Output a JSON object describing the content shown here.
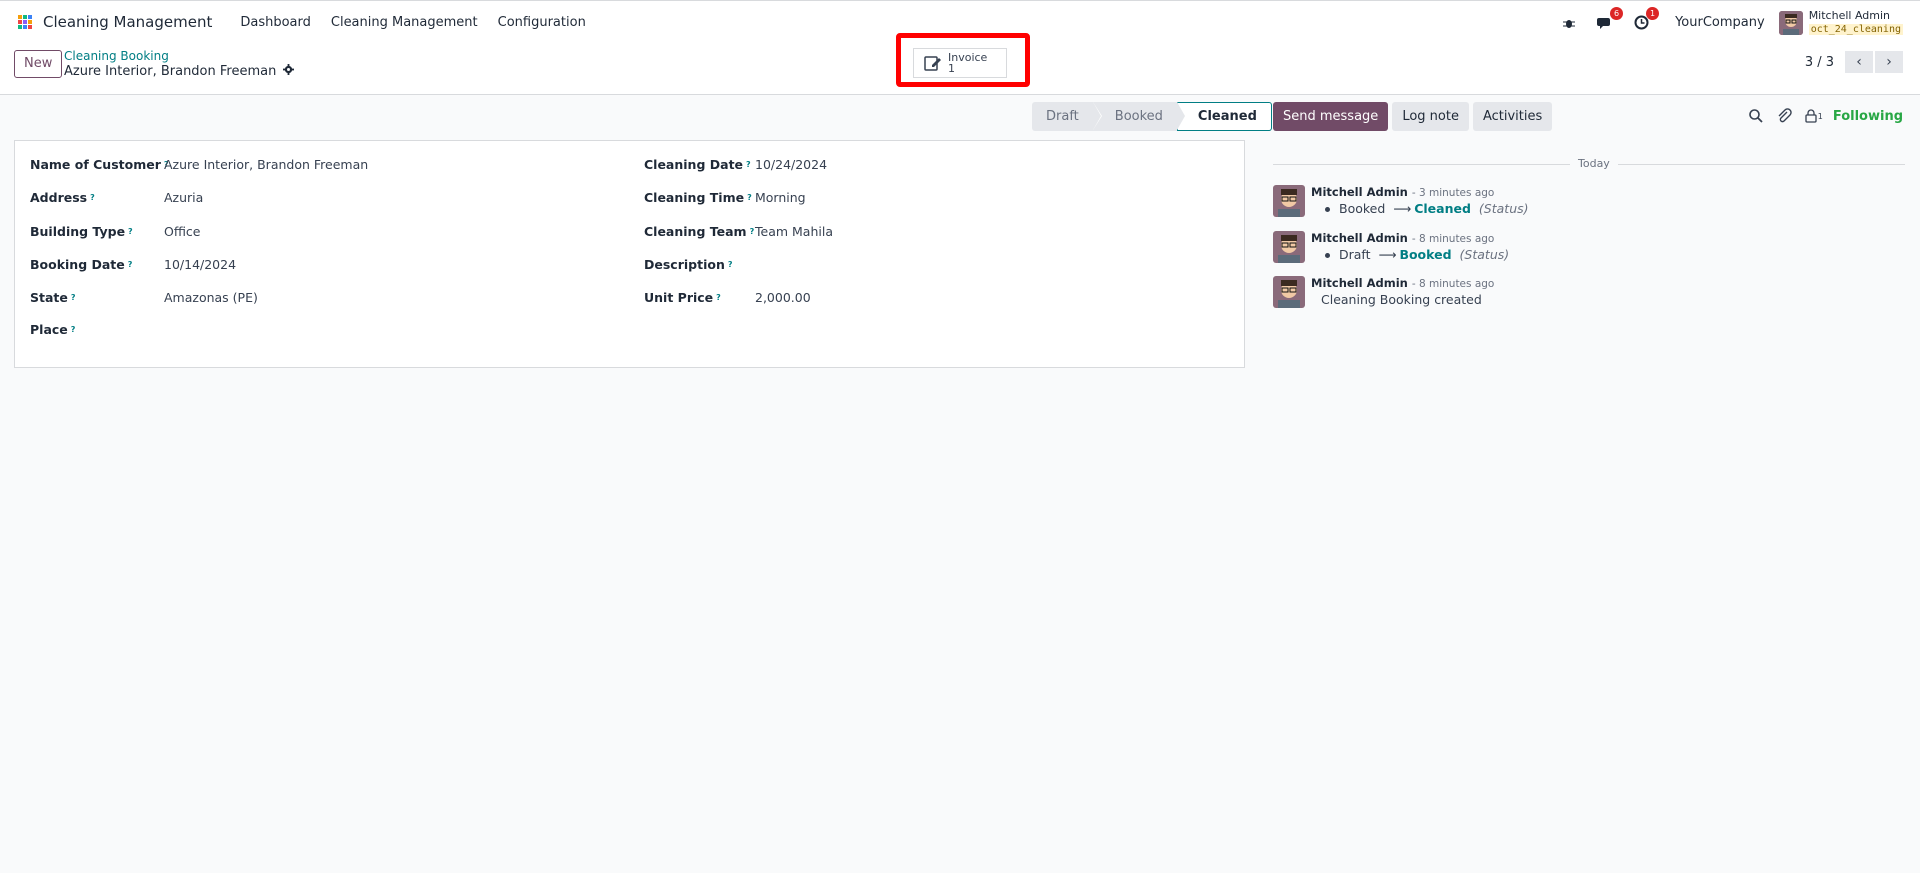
{
  "navbar": {
    "brand": "Cleaning Management",
    "menu": [
      "Dashboard",
      "Cleaning Management",
      "Configuration"
    ],
    "messages_badge": "6",
    "activities_badge": "1",
    "company": "YourCompany",
    "user_name": "Mitchell Admin",
    "database": "oct_24_cleaning"
  },
  "control": {
    "new_label": "New",
    "breadcrumb_parent": "Cleaning Booking",
    "record_name": "Azure Interior, Brandon Freeman",
    "smart_button_label": "Invoice",
    "smart_button_count": "1",
    "pager": "3 / 3"
  },
  "statusbar": {
    "stages": [
      "Draft",
      "Booked",
      "Cleaned"
    ],
    "active": "Cleaned"
  },
  "form": {
    "left": [
      {
        "label": "Name of Customer",
        "value": "Azure Interior, Brandon Freeman"
      },
      {
        "label": "Address",
        "value": "Azuria"
      },
      {
        "label": "Building Type",
        "value": "Office"
      },
      {
        "label": "Booking Date",
        "value": "10/14/2024"
      },
      {
        "label": "State",
        "value": "Amazonas (PE)"
      },
      {
        "label": "Place",
        "value": ""
      }
    ],
    "right": [
      {
        "label": "Cleaning Date",
        "value": "10/24/2024"
      },
      {
        "label": "Cleaning Time",
        "value": "Morning"
      },
      {
        "label": "Cleaning Team",
        "value": "Team Mahila"
      },
      {
        "label": "Description",
        "value": ""
      },
      {
        "label": "Unit Price",
        "value": "2,000.00"
      }
    ],
    "help_mark": "?"
  },
  "chatter": {
    "send_message": "Send message",
    "log_note": "Log note",
    "activities": "Activities",
    "followers_count": "1",
    "following": "Following",
    "today": "Today",
    "messages": [
      {
        "author": "Mitchell Admin",
        "time": "- 3 minutes ago",
        "old": "Booked",
        "new": "Cleaned",
        "field": "(Status)"
      },
      {
        "author": "Mitchell Admin",
        "time": "- 8 minutes ago",
        "old": "Draft",
        "new": "Booked",
        "field": "(Status)"
      },
      {
        "author": "Mitchell Admin",
        "time": "- 8 minutes ago",
        "text": "Cleaning Booking created"
      }
    ]
  },
  "colors": {
    "brand": "#714b67",
    "link": "#017e84",
    "following": "#28a745",
    "highlight": "#ff0000"
  }
}
